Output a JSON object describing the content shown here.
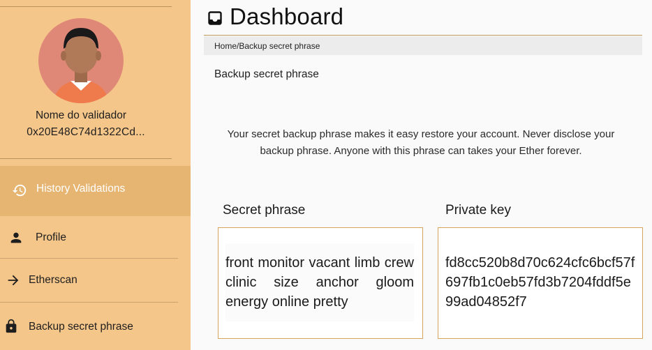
{
  "sidebar": {
    "user_name": "Nome do validador",
    "user_address": "0x20E48C74d1322Cd...",
    "items": [
      {
        "label": "History Validations",
        "icon": "history-icon",
        "active": true
      },
      {
        "label": "Profile",
        "icon": "person-icon",
        "active": false
      },
      {
        "label": "Etherscan",
        "icon": "arrow-right-icon",
        "active": false
      },
      {
        "label": "Backup secret phrase",
        "icon": "lock-icon",
        "active": false
      }
    ],
    "colors": {
      "background": "#f5c68a",
      "active": "#e6b572"
    }
  },
  "header": {
    "title": "Dashboard",
    "icon": "inbox-icon",
    "breadcrumb": "Home/Backup secret phrase"
  },
  "main": {
    "subheading": "Backup secret phrase",
    "info": "Your secret backup phrase makes it easy restore your account. Never disclose your backup phrase. Anyone with this phrase can takes your Ether forever.",
    "secret_label": "Secret phrase",
    "secret_phrase": "front monitor vacant limb crew clinic size anchor gloom energy online pretty",
    "key_label": "Private key",
    "private_key": "fd8cc520b8d70c624cfc6bcf57f697fb1c0eb57fd3b7204fddf5e99ad04852f7",
    "accent_color": "#d6a45d"
  }
}
